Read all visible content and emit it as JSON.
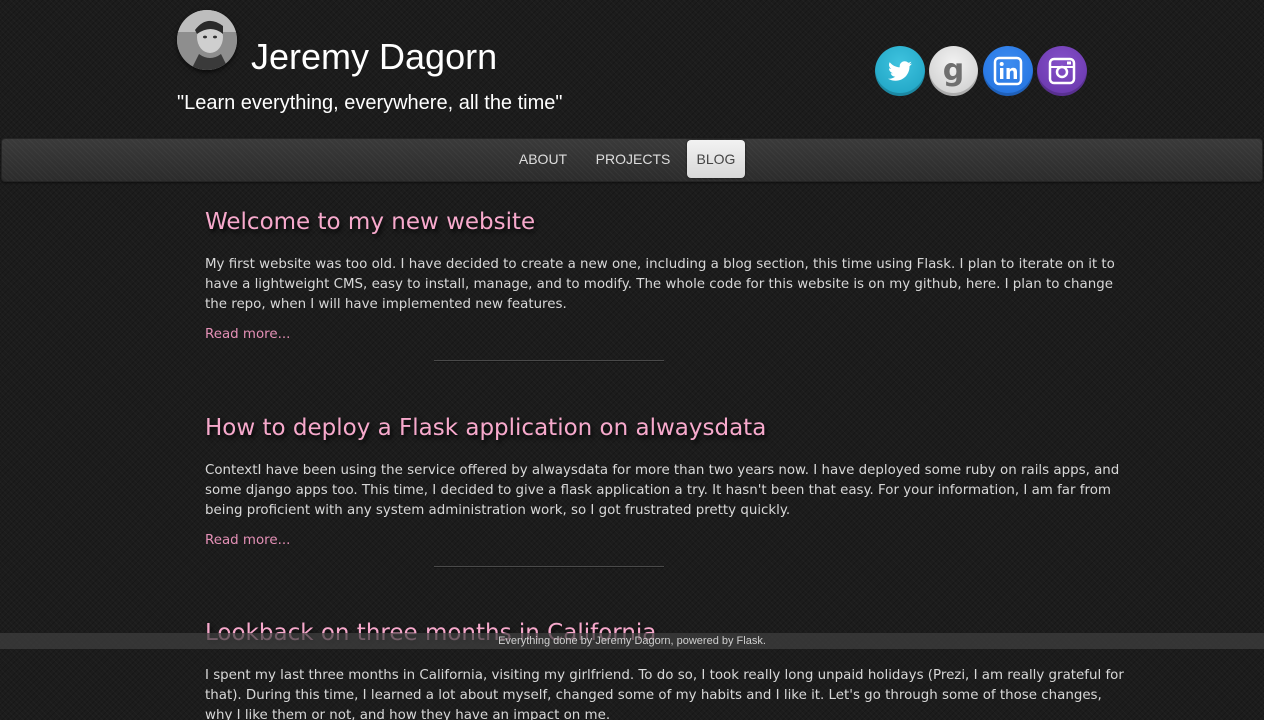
{
  "header": {
    "name": "Jeremy Dagorn",
    "tagline": "\"Learn everything, everywhere, all the time\"",
    "avatar_icon": "user-avatar-photo",
    "social": [
      {
        "name": "twitter",
        "icon": "twitter-bird-icon",
        "color": "#1a9fc0"
      },
      {
        "name": "google",
        "icon": "google-g-icon",
        "color": "#d8d8d8"
      },
      {
        "name": "linkedin",
        "icon": "linkedin-in-icon",
        "color": "#1f6fde"
      },
      {
        "name": "instagram",
        "icon": "instagram-camera-icon",
        "color": "#6534a8"
      }
    ]
  },
  "nav": {
    "items": [
      {
        "label": "ABOUT",
        "active": false
      },
      {
        "label": "PROJECTS",
        "active": false
      },
      {
        "label": "BLOG",
        "active": true
      }
    ]
  },
  "posts": [
    {
      "title": "Welcome to my new website",
      "excerpt": "My first website was too old. I have decided to create a new one, including a blog section, this time using Flask. I plan to iterate on it to have a lightweight CMS, easy to install, manage, and to modify. The whole code for this website is on my github, here. I plan to change the repo, when I will have implemented new features.",
      "read_more": "Read more..."
    },
    {
      "title": "How to deploy a Flask application on alwaysdata",
      "excerpt": "ContextI have been using the service offered by alwaysdata for more than two years now. I have deployed some ruby on rails apps, and some django apps too. This time, I decided to give a flask application a try. It hasn't been that easy. For your information, I am far from being proficient with any system administration work, so I got frustrated pretty quickly.",
      "read_more": "Read more..."
    },
    {
      "title": "Lookback on three months in California",
      "excerpt": "I spent my last three months in California, visiting my girlfriend. To do so, I took really long unpaid holidays (Prezi, I am really grateful for that). During this time, I learned a lot about myself, changed some of my habits and I like it. Let's go through some of those changes, why I like them or not, and how they have an impact on me."
    }
  ],
  "footer": {
    "text": "Everything done by Jeremy Dagorn, powered by Flask."
  },
  "colors": {
    "background": "#1c1c1c",
    "post_title": "#f7a9cc",
    "link": "#e490b6",
    "body_text": "#d8d8d8"
  }
}
